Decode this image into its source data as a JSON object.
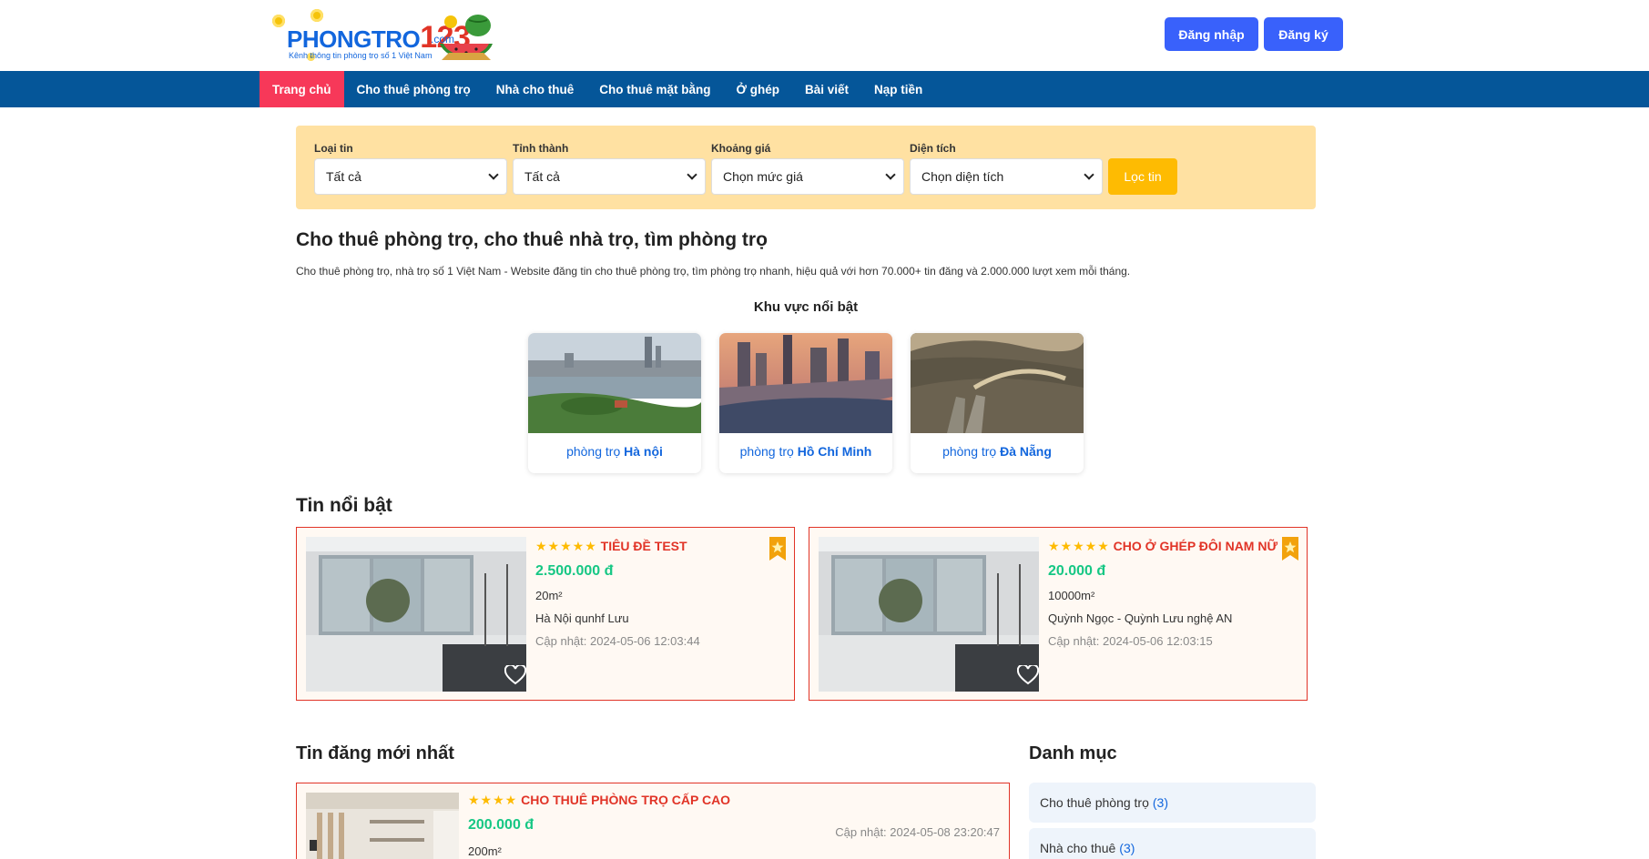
{
  "header": {
    "logo": {
      "brand_left": "PHONGTRO",
      "brand_right": "123",
      "domain": ".com",
      "tagline": "Kênh thông tin phòng trọ số 1 Việt Nam"
    },
    "login_label": "Đăng nhập",
    "register_label": "Đăng ký",
    "button_color": "#3961fb"
  },
  "nav": {
    "items": [
      {
        "label": "Trang chủ",
        "active": true
      },
      {
        "label": "Cho thuê phòng trọ"
      },
      {
        "label": "Nhà cho thuê"
      },
      {
        "label": "Cho thuê mặt bằng"
      },
      {
        "label": "Ở ghép"
      },
      {
        "label": "Bài viết"
      },
      {
        "label": "Nạp tiền"
      }
    ],
    "bg_color": "#055699",
    "active_color": "#f73859"
  },
  "filter": {
    "type": {
      "label": "Loại tin",
      "value": "Tất cả"
    },
    "province": {
      "label": "Tỉnh thành",
      "value": "Tất cả"
    },
    "price": {
      "label": "Khoảng giá",
      "value": "Chọn mức giá"
    },
    "area": {
      "label": "Diện tích",
      "value": "Chọn diện tích"
    },
    "submit_label": "Lọc tin"
  },
  "intro": {
    "title": "Cho thuê phòng trọ, cho thuê nhà trọ, tìm phòng trọ",
    "description": "Cho thuê phòng trọ, nhà trọ số 1 Việt Nam - Website đăng tin cho thuê phòng trọ, tìm phòng trọ nhanh, hiệu quả với hơn 70.000+ tin đăng và 2.000.000 lượt xem mỗi tháng."
  },
  "featured_areas": {
    "title": "Khu vực nổi bật",
    "items": [
      {
        "prefix": "phòng trọ",
        "city": "Hà nội"
      },
      {
        "prefix": "phòng trọ",
        "city": "Hồ Chí Minh"
      },
      {
        "prefix": "phòng trọ",
        "city": "Đà Nẵng"
      }
    ]
  },
  "featured_posts": {
    "title": "Tin nổi bật",
    "items": [
      {
        "stars": "★★★★★",
        "title": "TIÊU ĐỀ TEST",
        "price": "2.500.000 đ",
        "area": "20m²",
        "address": "Hà Nội qunhf Lưu",
        "updated": "Cập nhật: 2024-05-06 12:03:44"
      },
      {
        "stars": "★★★★★",
        "title": "CHO Ở GHÉP ĐÔI NAM NỮ",
        "price": "20.000 đ",
        "area": "10000m²",
        "address": "Quỳnh Ngọc - Quỳnh Lưu nghệ AN",
        "updated": "Cập nhật: 2024-05-06 12:03:15"
      }
    ]
  },
  "latest_posts": {
    "title": "Tin đăng mới nhất",
    "items": [
      {
        "stars": "★★★★",
        "title": "CHO THUÊ PHÒNG TRỌ CẤP CAO",
        "price": "200.000 đ",
        "area": "200m²",
        "updated": "Cập nhật: 2024-05-08 23:20:47"
      }
    ]
  },
  "categories": {
    "title": "Danh mục",
    "items": [
      {
        "label": "Cho thuê phòng trọ",
        "count": "(3)"
      },
      {
        "label": "Nhà cho thuê",
        "count": "(3)"
      }
    ]
  }
}
